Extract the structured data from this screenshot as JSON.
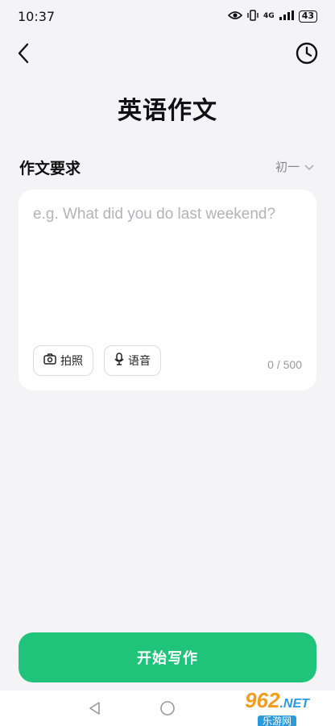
{
  "status_bar": {
    "time": "10:37",
    "network": "4G",
    "battery": "43"
  },
  "header": {
    "title": "英语作文"
  },
  "requirements": {
    "label": "作文要求",
    "grade": "初一",
    "placeholder": "e.g. What did you do last weekend?",
    "photo_label": "拍照",
    "voice_label": "语音",
    "counter": "0 / 500"
  },
  "action": {
    "start_label": "开始写作"
  },
  "watermark": {
    "brand": "962",
    "domain": ".NET",
    "subtitle": "乐游网"
  },
  "colors": {
    "accent": "#1fc47a",
    "background": "#f4f4f7"
  }
}
